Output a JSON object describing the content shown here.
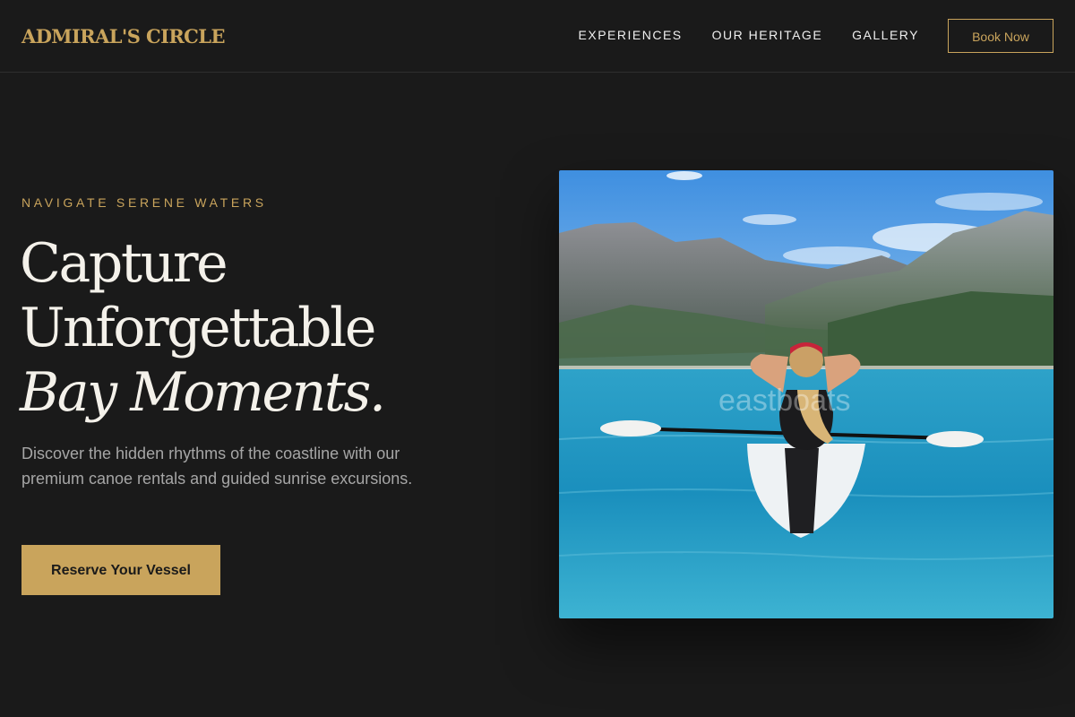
{
  "header": {
    "logo": "ADMIRAL'S CIRCLE",
    "nav": [
      {
        "label": "EXPERIENCES"
      },
      {
        "label": "OUR HERITAGE"
      },
      {
        "label": "GALLERY"
      }
    ],
    "book_label": "Book Now"
  },
  "hero": {
    "eyebrow": "NAVIGATE SERENE WATERS",
    "headline": {
      "line1": "Capture",
      "line2": "Unforgettable",
      "line3": "Bay Moments."
    },
    "lead": "Discover the hidden rhythms of the coastline with our premium canoe rentals and guided sunrise excursions.",
    "cta_label": "Reserve Your Vessel",
    "image_watermark": "eastboats"
  },
  "colors": {
    "background": "#1a1a1a",
    "accent": "#c9a45c",
    "text": "#f4f1ea",
    "muted": "#a6a6a6"
  }
}
